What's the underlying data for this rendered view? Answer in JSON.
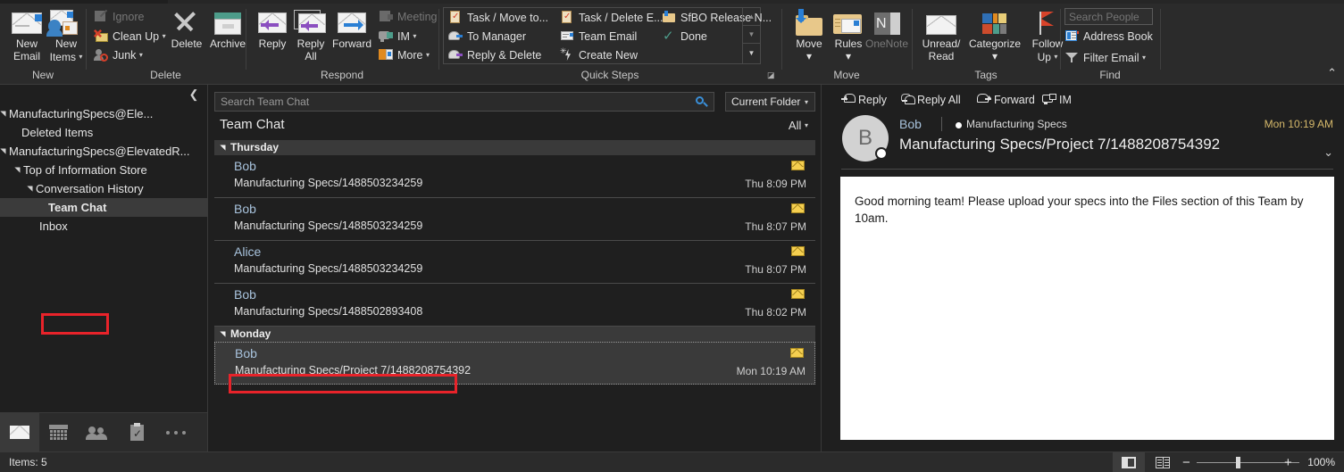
{
  "ribbon": {
    "groups": [
      {
        "label": "New"
      },
      {
        "label": "Delete"
      },
      {
        "label": "Respond"
      },
      {
        "label": "Quick Steps"
      },
      {
        "label": "Move"
      },
      {
        "label": "Tags"
      },
      {
        "label": "Find"
      }
    ],
    "new_group": {
      "new_email": "New\nEmail",
      "new_email_l1": "New",
      "new_email_l2": "Email",
      "new_items_l1": "New",
      "new_items_l2": "Items"
    },
    "delete_group": {
      "ignore": "Ignore",
      "clean_up": "Clean Up",
      "junk": "Junk",
      "delete": "Delete",
      "archive": "Archive"
    },
    "respond_group": {
      "reply": "Reply",
      "reply_all_l1": "Reply",
      "reply_all_l2": "All",
      "forward": "Forward",
      "meeting": "Meeting",
      "im": "IM",
      "more": "More"
    },
    "quick_steps": [
      "Task / Move to...",
      "Task / Delete E...",
      "SfBO Release N...",
      "To Manager",
      "Team Email",
      "Done",
      "Reply & Delete",
      "Create New"
    ],
    "move_group": {
      "move": "Move",
      "rules": "Rules",
      "onenote": "OneNote"
    },
    "tags_group": {
      "unread_l1": "Unread/",
      "unread_l2": "Read",
      "categorize": "Categorize",
      "followup_l1": "Follow",
      "followup_l2": "Up"
    },
    "find_group": {
      "search_people_placeholder": "Search People",
      "search_people_value": "",
      "address_book": "Address Book",
      "filter_email": "Filter Email"
    }
  },
  "sidebar": {
    "nodes": [
      {
        "label": "ManufacturingSpecs@Ele...",
        "indent": 10,
        "expander": true,
        "selected": false
      },
      {
        "label": "Deleted Items",
        "indent": 24,
        "expander": false,
        "selected": false
      },
      {
        "label": "ManufacturingSpecs@ElevatedR...",
        "indent": 10,
        "expander": true,
        "selected": false
      },
      {
        "label": "Top of Information Store",
        "indent": 26,
        "expander": true,
        "selected": false
      },
      {
        "label": "Conversation History",
        "indent": 40,
        "expander": true,
        "selected": false
      },
      {
        "label": "Team Chat",
        "indent": 54,
        "expander": false,
        "selected": true
      },
      {
        "label": "Inbox",
        "indent": 44,
        "expander": false,
        "selected": false
      }
    ],
    "modules": [
      {
        "name": "mail-module-button",
        "icon": "mail-icon",
        "active": true
      },
      {
        "name": "calendar-module-button",
        "icon": "calendar-icon",
        "active": false
      },
      {
        "name": "people-module-button",
        "icon": "people-icon",
        "active": false
      },
      {
        "name": "tasks-module-button",
        "icon": "tasks-icon",
        "active": false
      },
      {
        "name": "more-module-button",
        "icon": "ellipsis-icon",
        "active": false
      }
    ]
  },
  "message_list": {
    "search_placeholder": "Search Team Chat",
    "search_value": "",
    "scope": "Current Folder",
    "title": "Team Chat",
    "filter": "All",
    "groups": [
      {
        "name": "Thursday",
        "messages": [
          {
            "from": "Bob",
            "subject": "Manufacturing Specs/1488503234259",
            "time": "Thu 8:09 PM",
            "selected": false
          },
          {
            "from": "Bob",
            "subject": "Manufacturing Specs/1488503234259",
            "time": "Thu 8:07 PM",
            "selected": false
          },
          {
            "from": "Alice",
            "subject": "Manufacturing Specs/1488503234259",
            "time": "Thu 8:07 PM",
            "selected": false
          },
          {
            "from": "Bob",
            "subject": "Manufacturing Specs/1488502893408",
            "time": "Thu 8:02 PM",
            "selected": false
          }
        ]
      },
      {
        "name": "Monday",
        "messages": [
          {
            "from": "Bob",
            "subject": "Manufacturing Specs/Project 7/1488208754392",
            "time": "Mon 10:19 AM",
            "selected": true
          }
        ]
      }
    ]
  },
  "reading_pane": {
    "actions": [
      "Reply",
      "Reply All",
      "Forward",
      "IM"
    ],
    "avatar_initial": "B",
    "from": "Bob",
    "team": "Manufacturing Specs",
    "date": "Mon 10:19 AM",
    "subject": "Manufacturing Specs/Project 7/1488208754392",
    "body": "Good morning team! Please upload your specs into the Files section of this Team by 10am."
  },
  "status_bar": {
    "items": "Items: 5",
    "zoom": "100%"
  },
  "colors": {
    "annotation": "#e8232a",
    "accent_blue": "#2a7fd4",
    "app_bg": "#1f1f1f",
    "ribbon_bg": "#2b2b2b"
  }
}
